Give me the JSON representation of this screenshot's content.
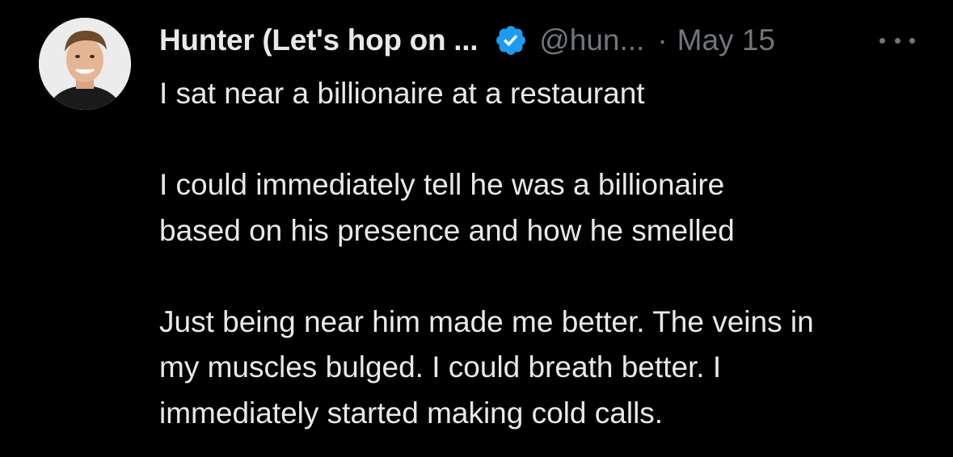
{
  "author": {
    "display_name": "Hunter (Let's hop on ...",
    "handle": "@hun...",
    "separator": "·",
    "date": "May 15",
    "verified": true,
    "verified_color": "#1d9bf0"
  },
  "tweet": {
    "paragraphs": [
      [
        "I sat near a billionaire at a restaurant"
      ],
      [
        "I could immediately tell he was a billionaire",
        "based on his presence and how he smelled"
      ],
      [
        "Just being near him made me better. The veins in",
        "my muscles bulged. I could breath better. I",
        "immediately started making cold calls."
      ]
    ]
  },
  "icons": {
    "verified": "verified-badge-icon",
    "more": "more-options-icon"
  },
  "colors": {
    "background": "#000000",
    "primary_text": "#e7e9ea",
    "secondary_text": "#71767b"
  }
}
